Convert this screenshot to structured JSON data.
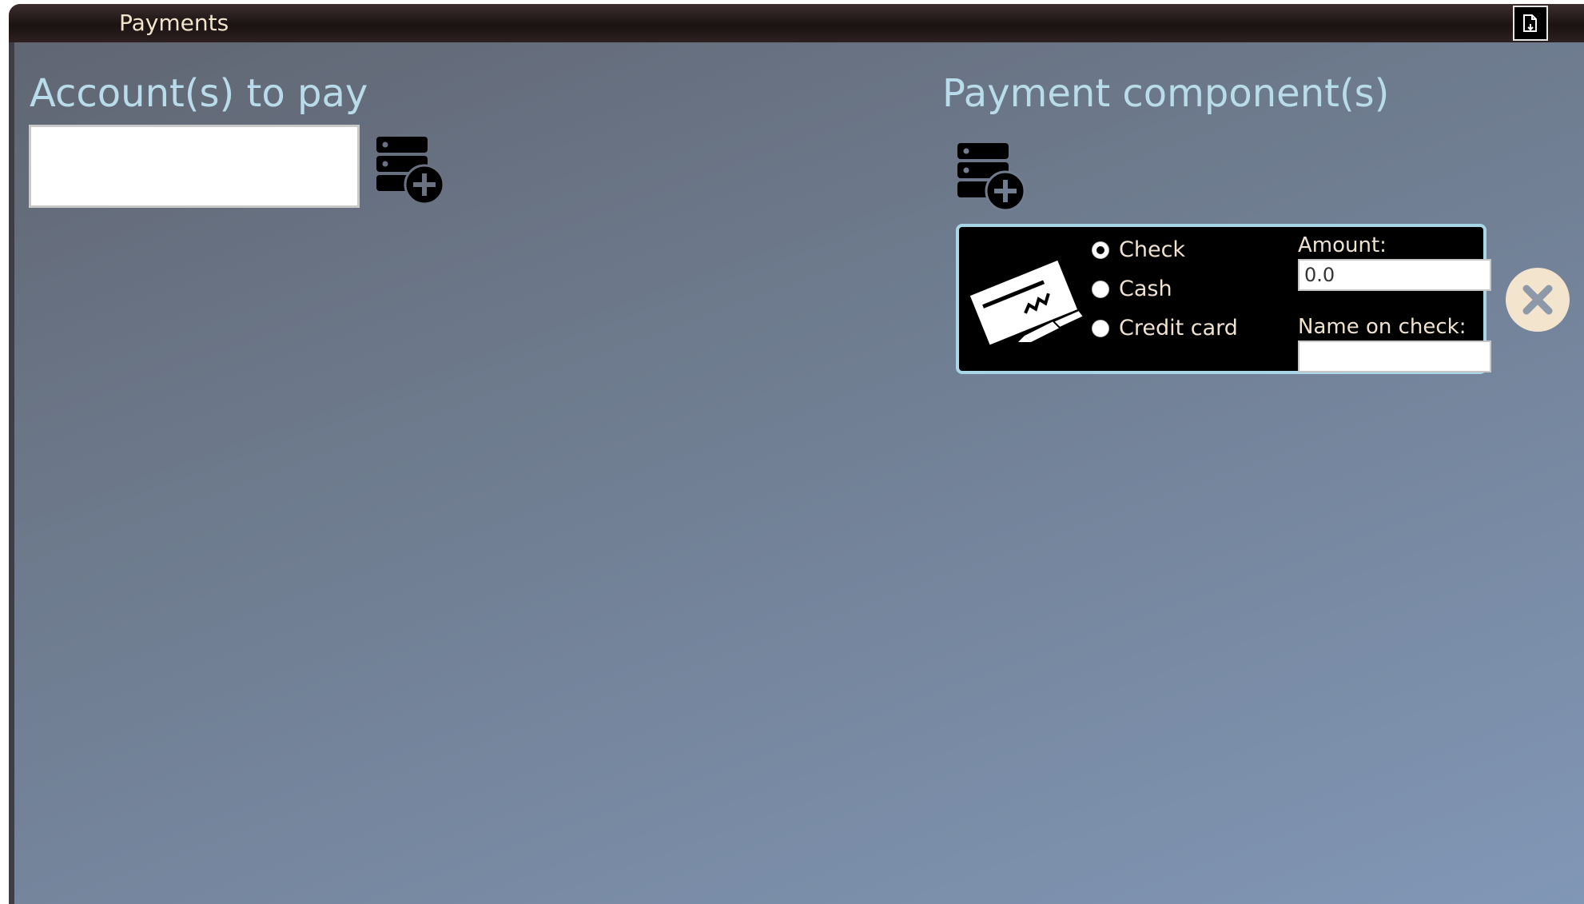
{
  "window": {
    "title": "Payments"
  },
  "icons": {
    "document": "document-icon",
    "add_record": "database-add-icon",
    "check": "check-payment-icon",
    "close": "close-icon"
  },
  "colors": {
    "section_title": "#b8dcea",
    "card_border": "#a9d6e6",
    "label_text": "#efe2d0",
    "remove_button": "#f3e4cd"
  },
  "accounts": {
    "title": "Account(s) to pay",
    "input_value": ""
  },
  "payments": {
    "title": "Payment component(s)",
    "components": [
      {
        "methods": [
          {
            "label": "Check",
            "selected": true
          },
          {
            "label": "Cash",
            "selected": false
          },
          {
            "label": "Credit card",
            "selected": false
          }
        ],
        "amount_label": "Amount:",
        "amount_value": "0.0",
        "name_label": "Name on check:",
        "name_value": ""
      }
    ]
  }
}
